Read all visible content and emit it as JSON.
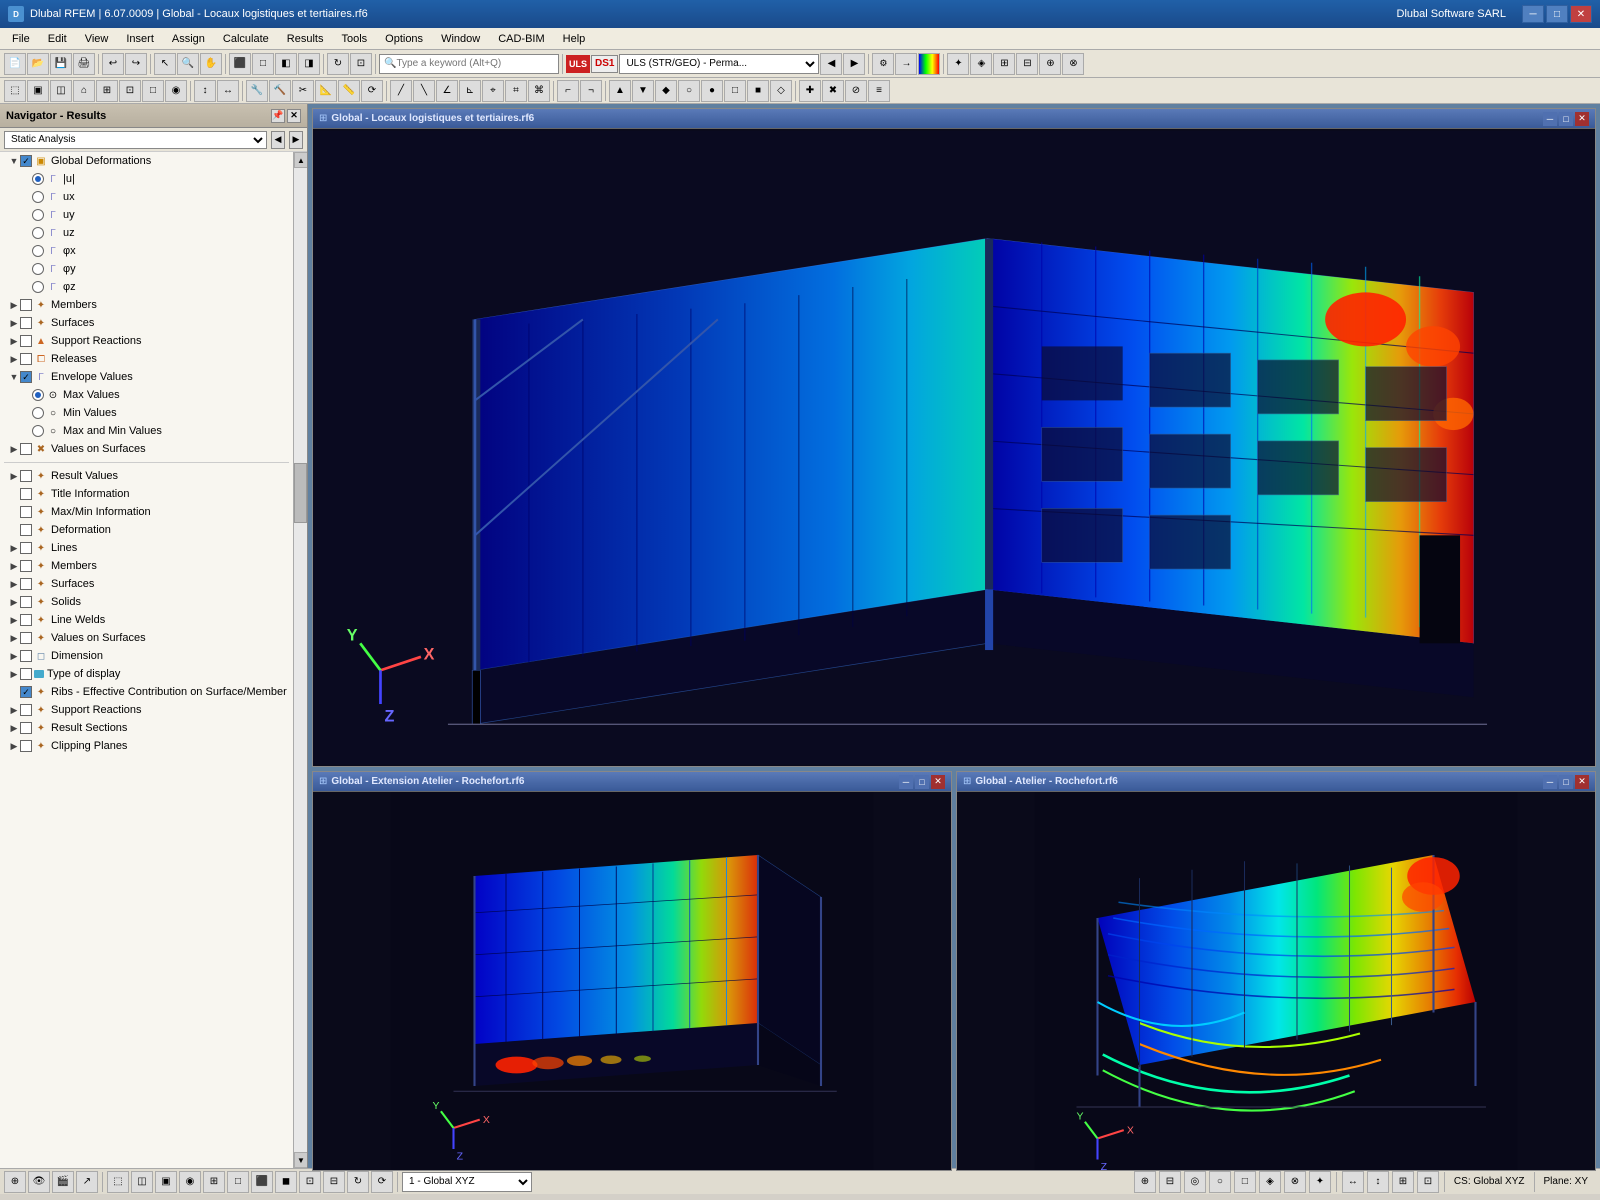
{
  "titleBar": {
    "icon": "D",
    "title": "Dlubal RFEM | 6.07.0009 | Global - Locaux logistiques et tertiaires.rf6",
    "rightText": "Dlubal Software SARL",
    "minBtn": "─",
    "maxBtn": "□",
    "closeBtn": "✕"
  },
  "menuBar": {
    "items": [
      "File",
      "Edit",
      "View",
      "Insert",
      "Assign",
      "Calculate",
      "Results",
      "Tools",
      "Options",
      "Window",
      "CAD-BIM",
      "Help"
    ]
  },
  "toolbar1": {
    "searchPlaceholder": "Type a keyword (Alt+Q)",
    "loadCase": "ULS (STR/GEO) - Perma...",
    "loadCaseCode": "DS1"
  },
  "navigator": {
    "title": "Navigator - Results",
    "comboValue": "Static Analysis",
    "tree": {
      "globalDeformations": {
        "label": "Global Deformations",
        "expanded": true,
        "items": [
          "|u|",
          "ux",
          "uy",
          "uz",
          "φx",
          "φy",
          "φz"
        ]
      },
      "members": "Members",
      "surfaces": "Surfaces",
      "supportReactions": "Support Reactions",
      "releases": "Releases",
      "envelopeValues": {
        "label": "Envelope Values",
        "expanded": true,
        "items": [
          "Max Values",
          "Min Values",
          "Max and Min Values"
        ]
      },
      "valuesOnSurfaces": "Values on Surfaces"
    },
    "tree2": {
      "resultValues": "Result Values",
      "titleInformation": "Title Information",
      "maxMinInformation": "Max/Min Information",
      "deformation": "Deformation",
      "lines": "Lines",
      "members": "Members",
      "surfaces": "Surfaces",
      "solids": "Solids",
      "lineWelds": "Line Welds",
      "valuesOnSurfaces": "Values on Surfaces",
      "dimension": "Dimension",
      "typeOfDisplay": "Type of display",
      "ribsEffective": "Ribs - Effective Contribution on Surface/Member",
      "supportReactions": "Support Reactions",
      "resultSections": "Result Sections",
      "clippingPlanes": "Clipping Planes"
    }
  },
  "modelWindows": {
    "top": {
      "title": "Global - Locaux logistiques et tertiaires.rf6"
    },
    "bottomLeft": {
      "title": "Global - Extension Atelier - Rochefort.rf6"
    },
    "bottomRight": {
      "title": "Global - Atelier - Rochefort.rf6"
    }
  },
  "statusBar": {
    "viewCombo": "1 - Global XYZ",
    "csLabel": "CS: Global XYZ",
    "planeLabel": "Plane: XY",
    "icons": [
      "⊕",
      "👁",
      "🎬",
      "↗"
    ]
  },
  "bottomToolbar": {
    "items": []
  },
  "axes": {
    "x": "X",
    "y": "Y",
    "z": "Z"
  }
}
